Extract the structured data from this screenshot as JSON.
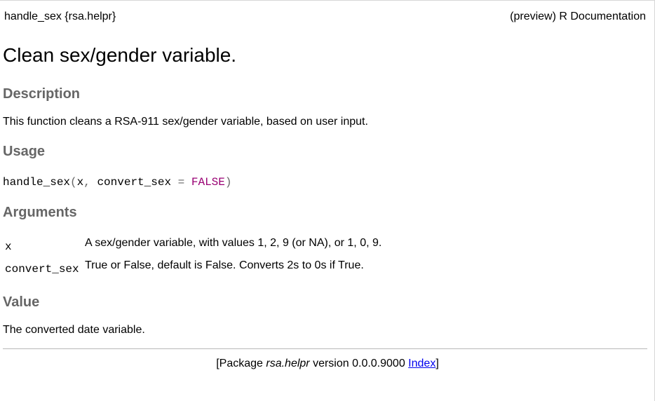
{
  "header": {
    "left": "handle_sex {rsa.helpr}",
    "right": "(preview) R Documentation"
  },
  "title": "Clean sex/gender variable.",
  "description": {
    "heading": "Description",
    "text": "This function cleans a RSA-911 sex/gender variable, based on user input."
  },
  "usage": {
    "heading": "Usage",
    "fn": "handle_sex",
    "open": "(",
    "arg1": "x",
    "comma": ", ",
    "arg2": "convert_sex",
    "eq": " = ",
    "default": "FALSE",
    "close": ")"
  },
  "arguments": {
    "heading": "Arguments",
    "items": [
      {
        "name": "x",
        "desc": "A sex/gender variable, with values 1, 2, 9 (or NA), or 1, 0, 9."
      },
      {
        "name": "convert_sex",
        "desc": "True or False, default is False. Converts 2s to 0s if True."
      }
    ]
  },
  "value": {
    "heading": "Value",
    "text": "The converted date variable."
  },
  "footer": {
    "prefix": "[Package ",
    "package": "rsa.helpr",
    "version": " version 0.0.0.9000 ",
    "index_link": "Index",
    "suffix": "]"
  },
  "colors": {
    "heading": "#666666",
    "link": "#0000ee",
    "constant": "#990073"
  }
}
